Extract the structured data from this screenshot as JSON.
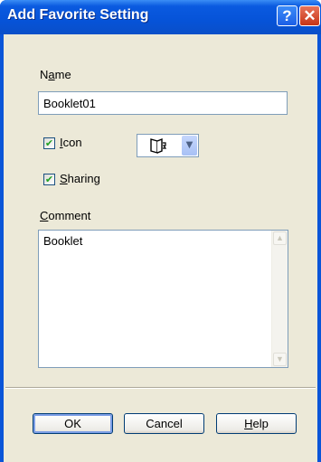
{
  "window": {
    "title": "Add Favorite Setting",
    "help_glyph": "?",
    "close_glyph": "✕"
  },
  "name": {
    "label_pre": "N",
    "label_accel": "a",
    "label_post": "me",
    "value": "Booklet01"
  },
  "icon": {
    "checked": true,
    "label_accel": "I",
    "label_post": "con",
    "selected_icon": "booklet-icon"
  },
  "sharing": {
    "checked": true,
    "label_accel": "S",
    "label_post": "haring"
  },
  "comment": {
    "label_accel": "C",
    "label_post": "omment",
    "value": "Booklet"
  },
  "buttons": {
    "ok": "OK",
    "cancel": "Cancel",
    "help_accel": "H",
    "help_post": "elp"
  },
  "colors": {
    "titlebar": "#0a55d8",
    "dialog_bg": "#ece9d8",
    "close_button": "#c73416",
    "check_mark": "#21a121"
  }
}
